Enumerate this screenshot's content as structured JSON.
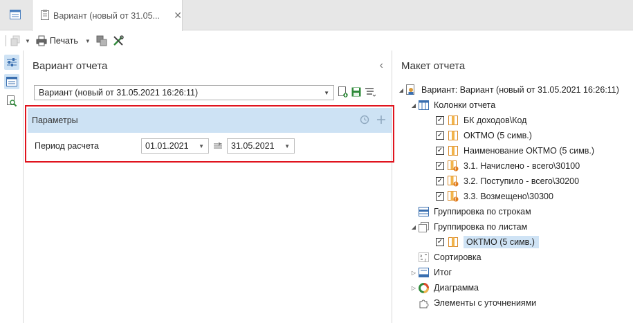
{
  "tabs": {
    "document_title": "Вариант (новый от 31.05..."
  },
  "toolbar": {
    "print_label": "Печать"
  },
  "left_panel": {
    "title": "Вариант отчета",
    "variant_value": "Вариант (новый от 31.05.2021 16:26:11)",
    "params_title": "Параметры",
    "period_label": "Период расчета",
    "date_from": "01.01.2021",
    "date_to": "31.05.2021"
  },
  "right_panel": {
    "title": "Макет отчета",
    "tree": {
      "root": "Вариант: Вариант (новый от 31.05.2021 16:26:11)",
      "columns": "Колонки отчета",
      "col1": "БК доходов\\Код",
      "col2": "ОКТМО (5 симв.)",
      "col3": "Наименование ОКТМО (5 симв.)",
      "col4": "3.1. Начислено - всего\\30100",
      "col5": "3.2. Поступило - всего\\30200",
      "col6": "3.3. Возмещено\\30300",
      "group_rows": "Группировка по строкам",
      "group_sheets": "Группировка по листам",
      "sheet1": "ОКТМО (5 симв.)",
      "sort": "Сортировка",
      "total": "Итог",
      "diagram": "Диаграмма",
      "elements": "Элементы с уточнениями"
    }
  }
}
